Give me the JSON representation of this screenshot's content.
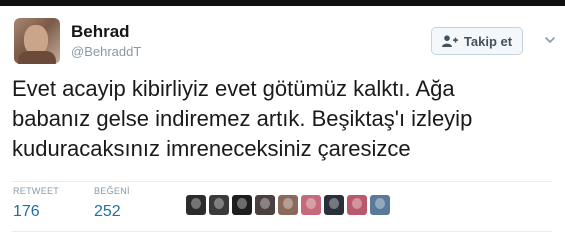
{
  "tweet": {
    "author": {
      "name": "Behrad",
      "handle": "@BehraddT"
    },
    "follow_button": {
      "label": "Takip et",
      "icon": "add-person-icon"
    },
    "text_lines": [
      "Evet acayip kibirliyiz evet götümüz kalktı. Ağa",
      "babanız gelse indiremez artık. Beşiktaş'ı izleyip",
      "kuduracaksınız imreneceksiniz çaresizce"
    ],
    "stats": {
      "retweet_label": "RETWEET",
      "retweet_count": "176",
      "like_label": "BEĞENİ",
      "like_count": "252"
    },
    "likers": [
      {
        "color": "#2b2b2b"
      },
      {
        "color": "#3a3a3a"
      },
      {
        "color": "#1e1e1e"
      },
      {
        "color": "#4a4040"
      },
      {
        "color": "#8a6a5a"
      },
      {
        "color": "#c46a7a"
      },
      {
        "color": "#2a2f3a"
      },
      {
        "color": "#b85a6a"
      },
      {
        "color": "#5a7a9a"
      }
    ]
  }
}
